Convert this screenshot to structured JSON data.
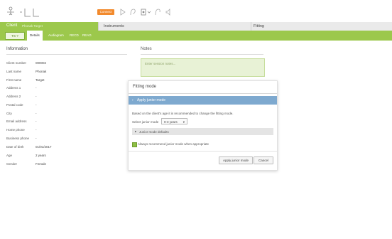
{
  "toolbar": {
    "connect_label": "Connect"
  },
  "tabs": {
    "client_label": "Client",
    "client_name": "Phonak Target",
    "instruments_label": "Instruments",
    "fitting_label": "Fitting"
  },
  "subnav": {
    "back_label": "TS ?",
    "tabs": [
      "Details",
      "Audiogram",
      "RECD",
      "REAG"
    ]
  },
  "information": {
    "title": "Information",
    "fields": [
      {
        "label": "Client number",
        "value": "000002"
      },
      {
        "label": "Last name",
        "value": "Phonak"
      },
      {
        "label": "First name",
        "value": "Target"
      },
      {
        "label": "Address 1",
        "value": "-"
      },
      {
        "label": "Address 2",
        "value": "-"
      },
      {
        "label": "Postal code",
        "value": "-"
      },
      {
        "label": "City",
        "value": "-"
      },
      {
        "label": "Email address",
        "value": "-"
      },
      {
        "label": "Home phone",
        "value": "-"
      },
      {
        "label": "Business phone",
        "value": "-"
      },
      {
        "label": "Date of birth",
        "value": "01/01/2017"
      },
      {
        "label": "Age",
        "value": "2 years"
      },
      {
        "label": "Gender",
        "value": "Female"
      }
    ]
  },
  "notes": {
    "title": "Notes",
    "placeholder": "Enter session notes..."
  },
  "dialog": {
    "title": "Fitting mode",
    "banner": "Apply junior mode",
    "description": "Based on the client's age it is recommended to change the fitting mode.",
    "select_label": "Select junior mode",
    "select_value": "0-3 years",
    "section_label": "Junior mode defaults",
    "checkbox_label": "Always recommend junior mode when appropriate",
    "apply_button": "Apply junior mode",
    "cancel_button": "Cancel"
  },
  "colors": {
    "accent_green": "#9cc84c",
    "connect_orange": "#f28a2d",
    "banner_blue": "#7ea9cf"
  }
}
